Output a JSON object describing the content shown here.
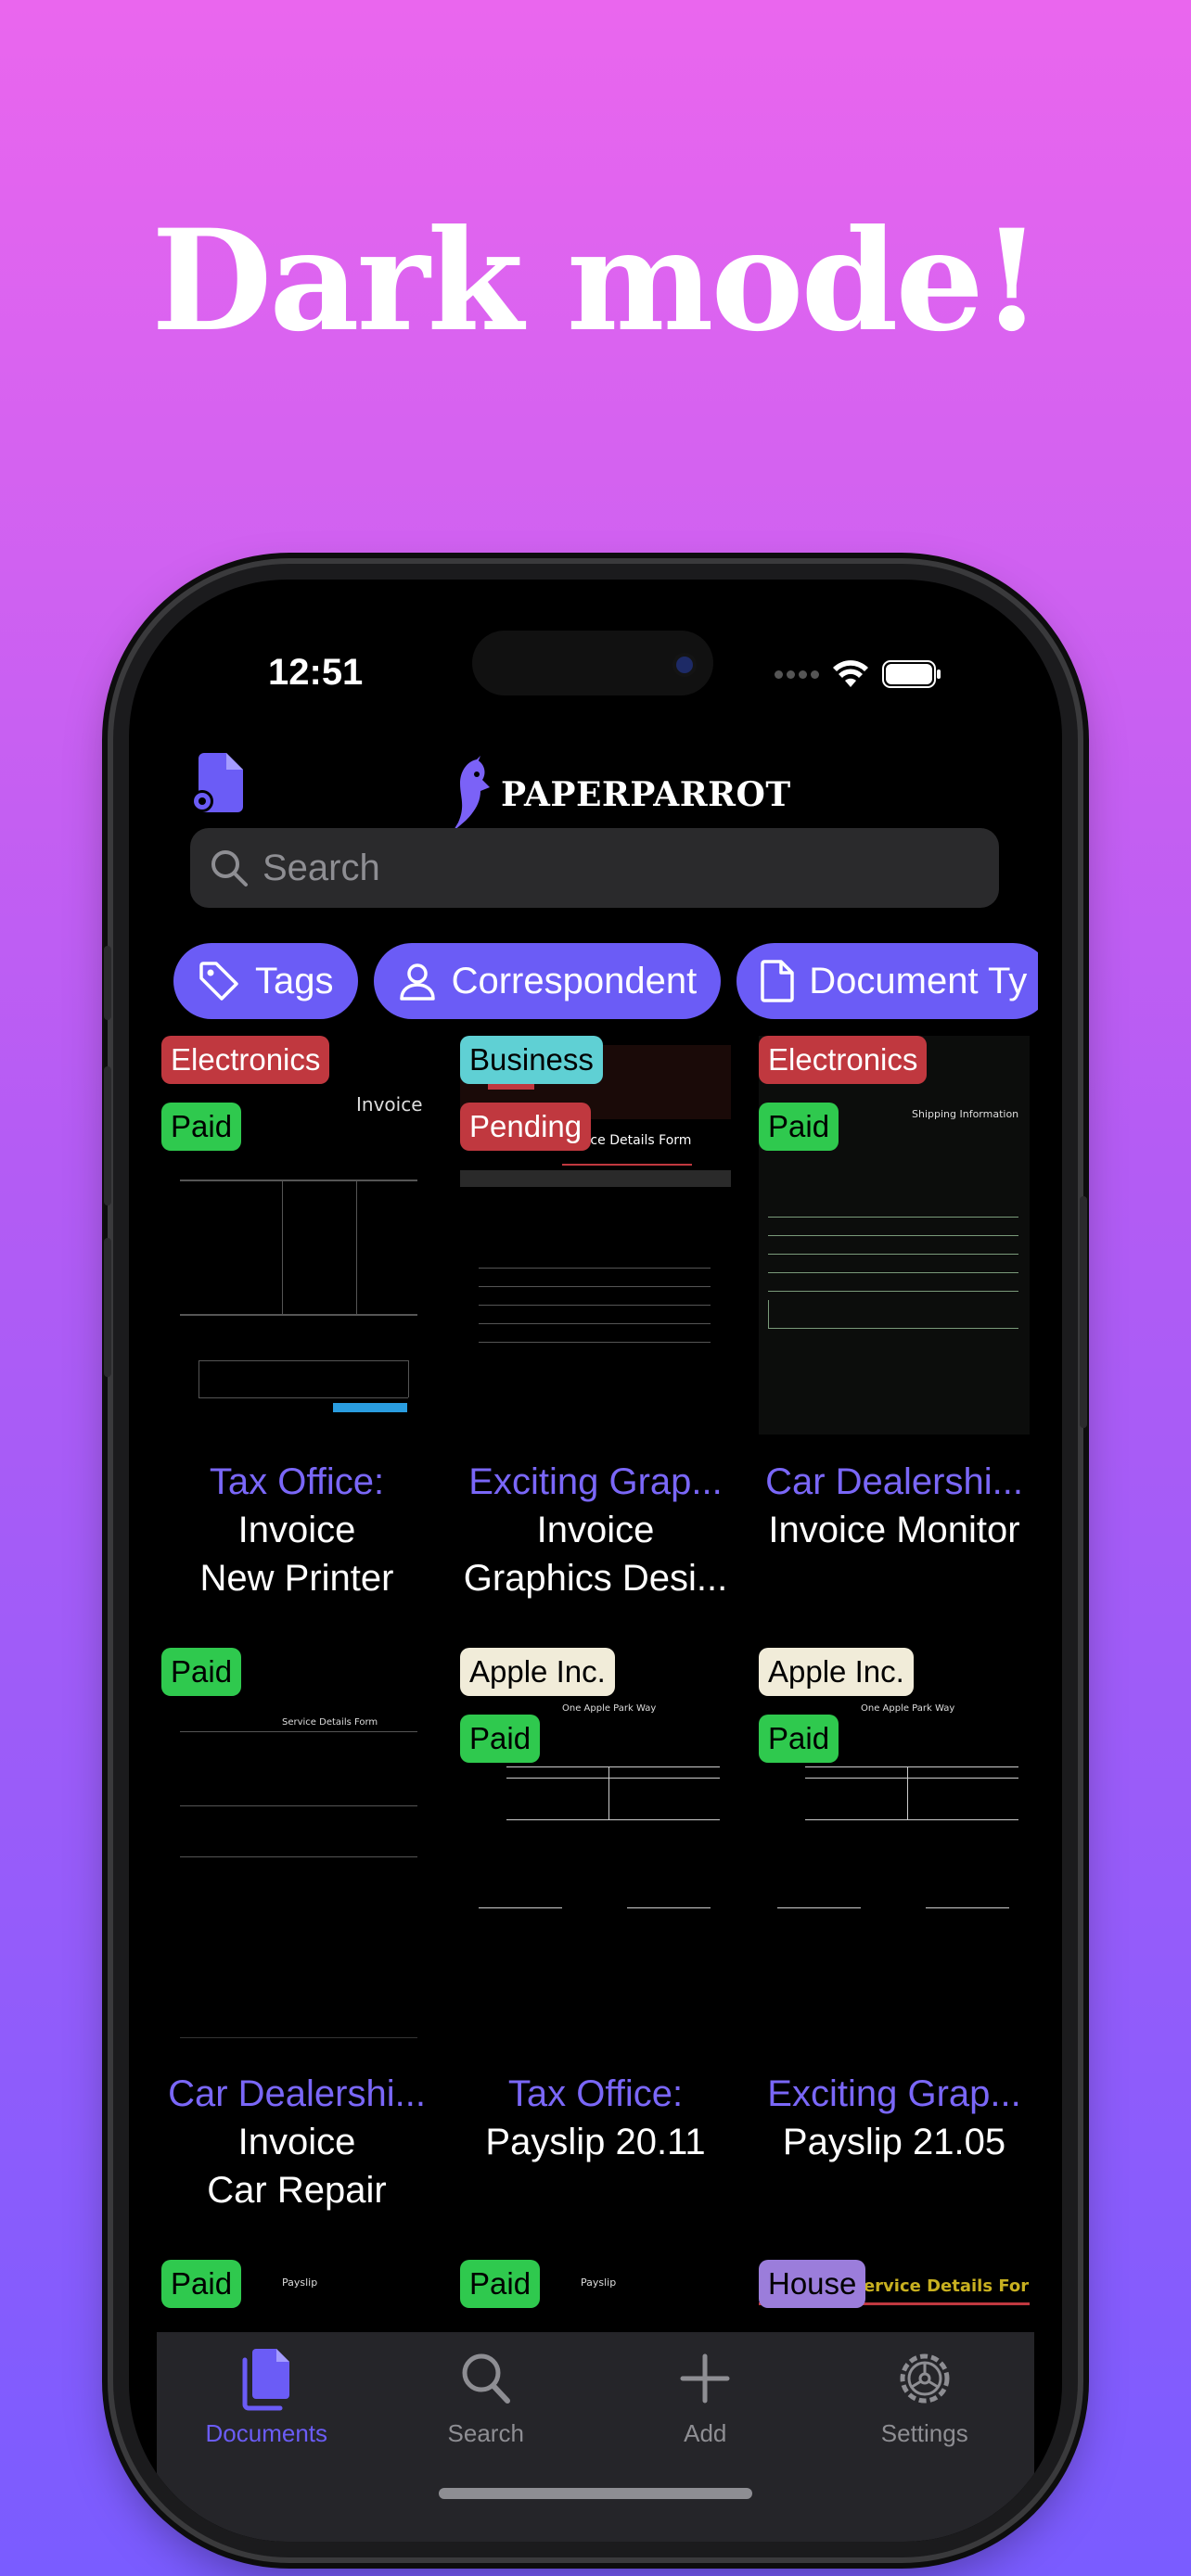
{
  "headline": "Dark mode!",
  "status": {
    "time": "12:51"
  },
  "app": {
    "logo_text": "PAPERPARROT"
  },
  "search": {
    "placeholder": "Search"
  },
  "filters": [
    {
      "label": "Tags",
      "icon": "tag-icon"
    },
    {
      "label": "Correspondent",
      "icon": "person-icon"
    },
    {
      "label": "Document Ty",
      "icon": "document-icon"
    }
  ],
  "documents": [
    {
      "badges": [
        {
          "label": "Electronics",
          "color": "#c0383f",
          "text": "#fff"
        },
        {
          "label": "Paid",
          "color": "#2fc94e",
          "text": "#000"
        }
      ],
      "correspondent": "Tax Office:",
      "type": "Invoice",
      "title": "New Printer",
      "thumb_title": "Invoice"
    },
    {
      "badges": [
        {
          "label": "Business",
          "color": "#5fd0d4",
          "text": "#000"
        },
        {
          "label": "Pending",
          "color": "#c0383f",
          "text": "#fff"
        }
      ],
      "correspondent": "Exciting Grap...",
      "type": "Invoice",
      "title": "Graphics Desi...",
      "thumb_title": "Service Details Form"
    },
    {
      "badges": [
        {
          "label": "Electronics",
          "color": "#c0383f",
          "text": "#fff"
        },
        {
          "label": "Paid",
          "color": "#2fc94e",
          "text": "#000"
        }
      ],
      "correspondent": "Car Dealershi...",
      "type": "Invoice Monitor",
      "title": "",
      "thumb_title": "Shipping Information"
    },
    {
      "badges": [
        {
          "label": "Paid",
          "color": "#2fc94e",
          "text": "#000"
        }
      ],
      "correspondent": "Car Dealershi...",
      "type": "Invoice",
      "title": "Car Repair",
      "thumb_title": "Service Details Form"
    },
    {
      "badges": [
        {
          "label": "Apple Inc.",
          "color": "#f1ecd9",
          "text": "#000"
        },
        {
          "label": "Paid",
          "color": "#2fc94e",
          "text": "#000"
        }
      ],
      "correspondent": "Tax Office:",
      "type": "Payslip 20.11",
      "title": "",
      "thumb_title": "One Apple Park Way"
    },
    {
      "badges": [
        {
          "label": "Apple Inc.",
          "color": "#f1ecd9",
          "text": "#000"
        },
        {
          "label": "Paid",
          "color": "#2fc94e",
          "text": "#000"
        }
      ],
      "correspondent": "Exciting Grap...",
      "type": "Payslip 21.05",
      "title": "",
      "thumb_title": "One Apple Park Way"
    },
    {
      "badges": [
        {
          "label": "Paid",
          "color": "#2fc94e",
          "text": "#000"
        }
      ],
      "correspondent": "",
      "type": "",
      "title": "",
      "thumb_title": "Payslip"
    },
    {
      "badges": [
        {
          "label": "Paid",
          "color": "#2fc94e",
          "text": "#000"
        }
      ],
      "correspondent": "",
      "type": "",
      "title": "",
      "thumb_title": "Payslip"
    },
    {
      "badges": [
        {
          "label": "House",
          "color": "#9b7ddb",
          "text": "#000"
        }
      ],
      "correspondent": "",
      "type": "",
      "title": "",
      "thumb_title": "Service Details Form"
    }
  ],
  "tabs": [
    {
      "label": "Documents",
      "icon": "documents-icon",
      "active": true
    },
    {
      "label": "Search",
      "icon": "search-icon",
      "active": false
    },
    {
      "label": "Add",
      "icon": "plus-icon",
      "active": false
    },
    {
      "label": "Settings",
      "icon": "gear-icon",
      "active": false
    }
  ],
  "colors": {
    "accent": "#6b5cf6",
    "correspondent": "#7a67f8"
  }
}
